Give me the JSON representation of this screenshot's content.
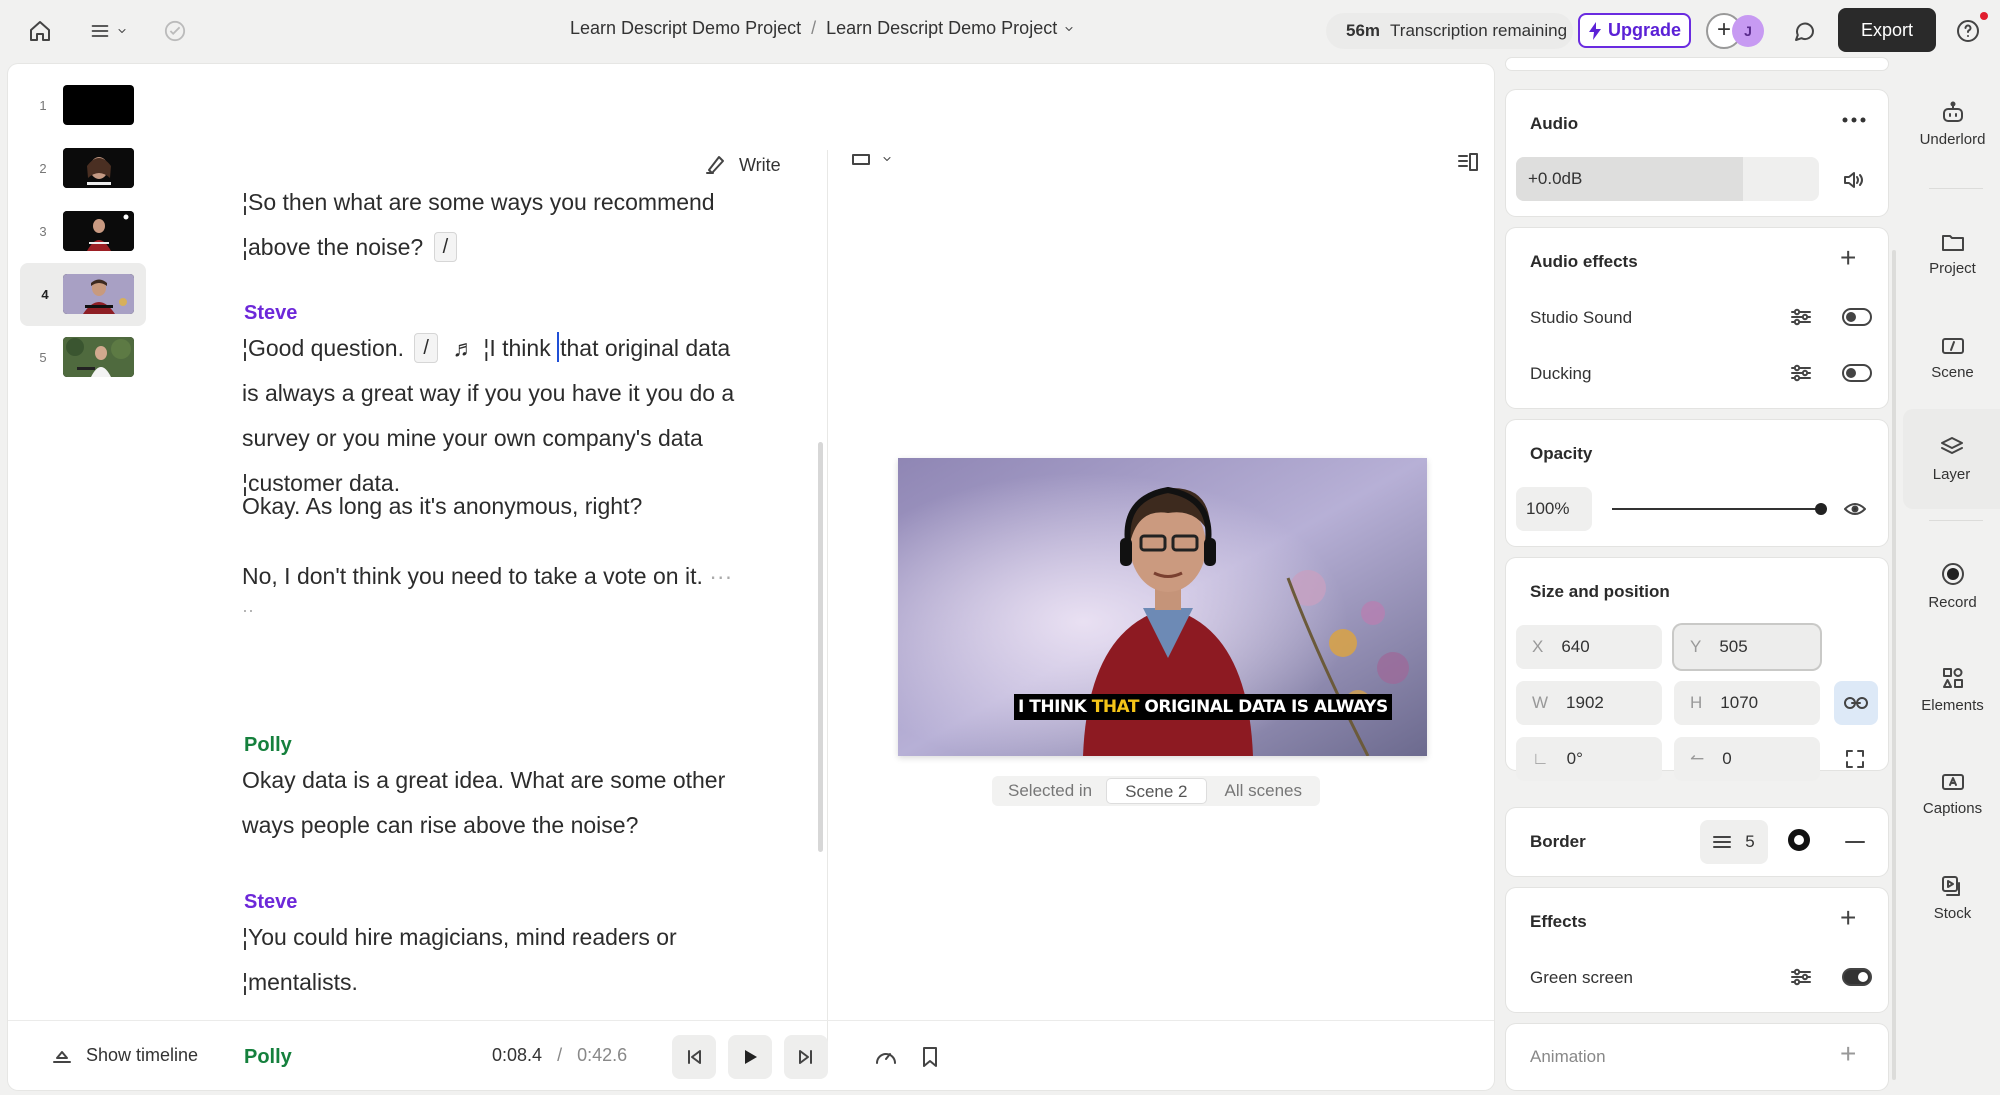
{
  "topbar": {
    "breadcrumb_project": "Learn Descript Demo Project",
    "breadcrumb_sep": "/",
    "breadcrumb_composition": "Learn Descript Demo Project",
    "transcription_minutes": "56m",
    "transcription_label": "Transcription remaining",
    "upgrade_label": "Upgrade",
    "avatar_initial": "J",
    "export_label": "Export",
    "icons": [
      "home-icon",
      "menu-icon",
      "chevron-down-icon",
      "check-circle-icon",
      "comment-icon",
      "help-icon"
    ]
  },
  "scenes": [
    {
      "num": "1"
    },
    {
      "num": "2"
    },
    {
      "num": "3"
    },
    {
      "num": "4"
    },
    {
      "num": "5"
    }
  ],
  "script": {
    "write_label": "Write",
    "p1_l1": "So then what are some ways you recommend",
    "p1_l2": "above the noise?",
    "gap_mark": "/",
    "speaker_steve": "Steve",
    "speaker_polly": "Polly",
    "p2_a": "Good question.",
    "p2_music": "♬",
    "p2_b": "I think",
    "p2_c": "that original data",
    "p2_l2": "is always a great way if you you have it you do a",
    "p2_l3": "survey or you mine your own company's data",
    "p2_l4": "customer data.",
    "p3": "Okay. As long as it's anonymous, right?",
    "p4": "No, I don't think you need to take a vote on it.",
    "p4_more": "···",
    "p4_dots": "··",
    "p5_l1": "Okay data is a great idea. What are some other",
    "p5_l2": "ways people can rise above the noise?",
    "p6_l1": "You could hire magicians, mind readers or",
    "p6_l2": "mentalists."
  },
  "canvas": {
    "caption_pre": "I THINK ",
    "caption_hl": "THAT",
    "caption_post": " ORIGINAL DATA IS ALWAYS",
    "selected_in_label": "Selected in",
    "scene_option": "Scene 2",
    "all_scenes_option": "All scenes",
    "colors": {
      "caption_highlight": "#f5c518",
      "accent": "#6a2be0"
    }
  },
  "transport": {
    "show_timeline_label": "Show timeline",
    "current_time": "0:08.4",
    "time_sep": "/",
    "total_time": "0:42.6"
  },
  "props": {
    "audio_title": "Audio",
    "audio_gain": "+0.0dB",
    "audio_effects_title": "Audio effects",
    "studio_sound_label": "Studio Sound",
    "studio_sound_on": false,
    "ducking_label": "Ducking",
    "ducking_on": false,
    "opacity_title": "Opacity",
    "opacity_value": "100%",
    "opacity_level": 1.0,
    "size_title": "Size and position",
    "x_key": "X",
    "x_val": "640",
    "y_key": "Y",
    "y_val": "505",
    "w_key": "W",
    "w_val": "1902",
    "h_key": "H",
    "h_val": "1070",
    "rot_val": "0°",
    "corner_val": "0",
    "border_title": "Border",
    "border_width": "5",
    "effects_title": "Effects",
    "green_screen_label": "Green screen",
    "green_screen_on": true,
    "animation_title": "Animation"
  },
  "rail": {
    "underlord": "Underlord",
    "project": "Project",
    "scene": "Scene",
    "layer": "Layer",
    "record": "Record",
    "elements": "Elements",
    "captions": "Captions",
    "stock": "Stock"
  }
}
